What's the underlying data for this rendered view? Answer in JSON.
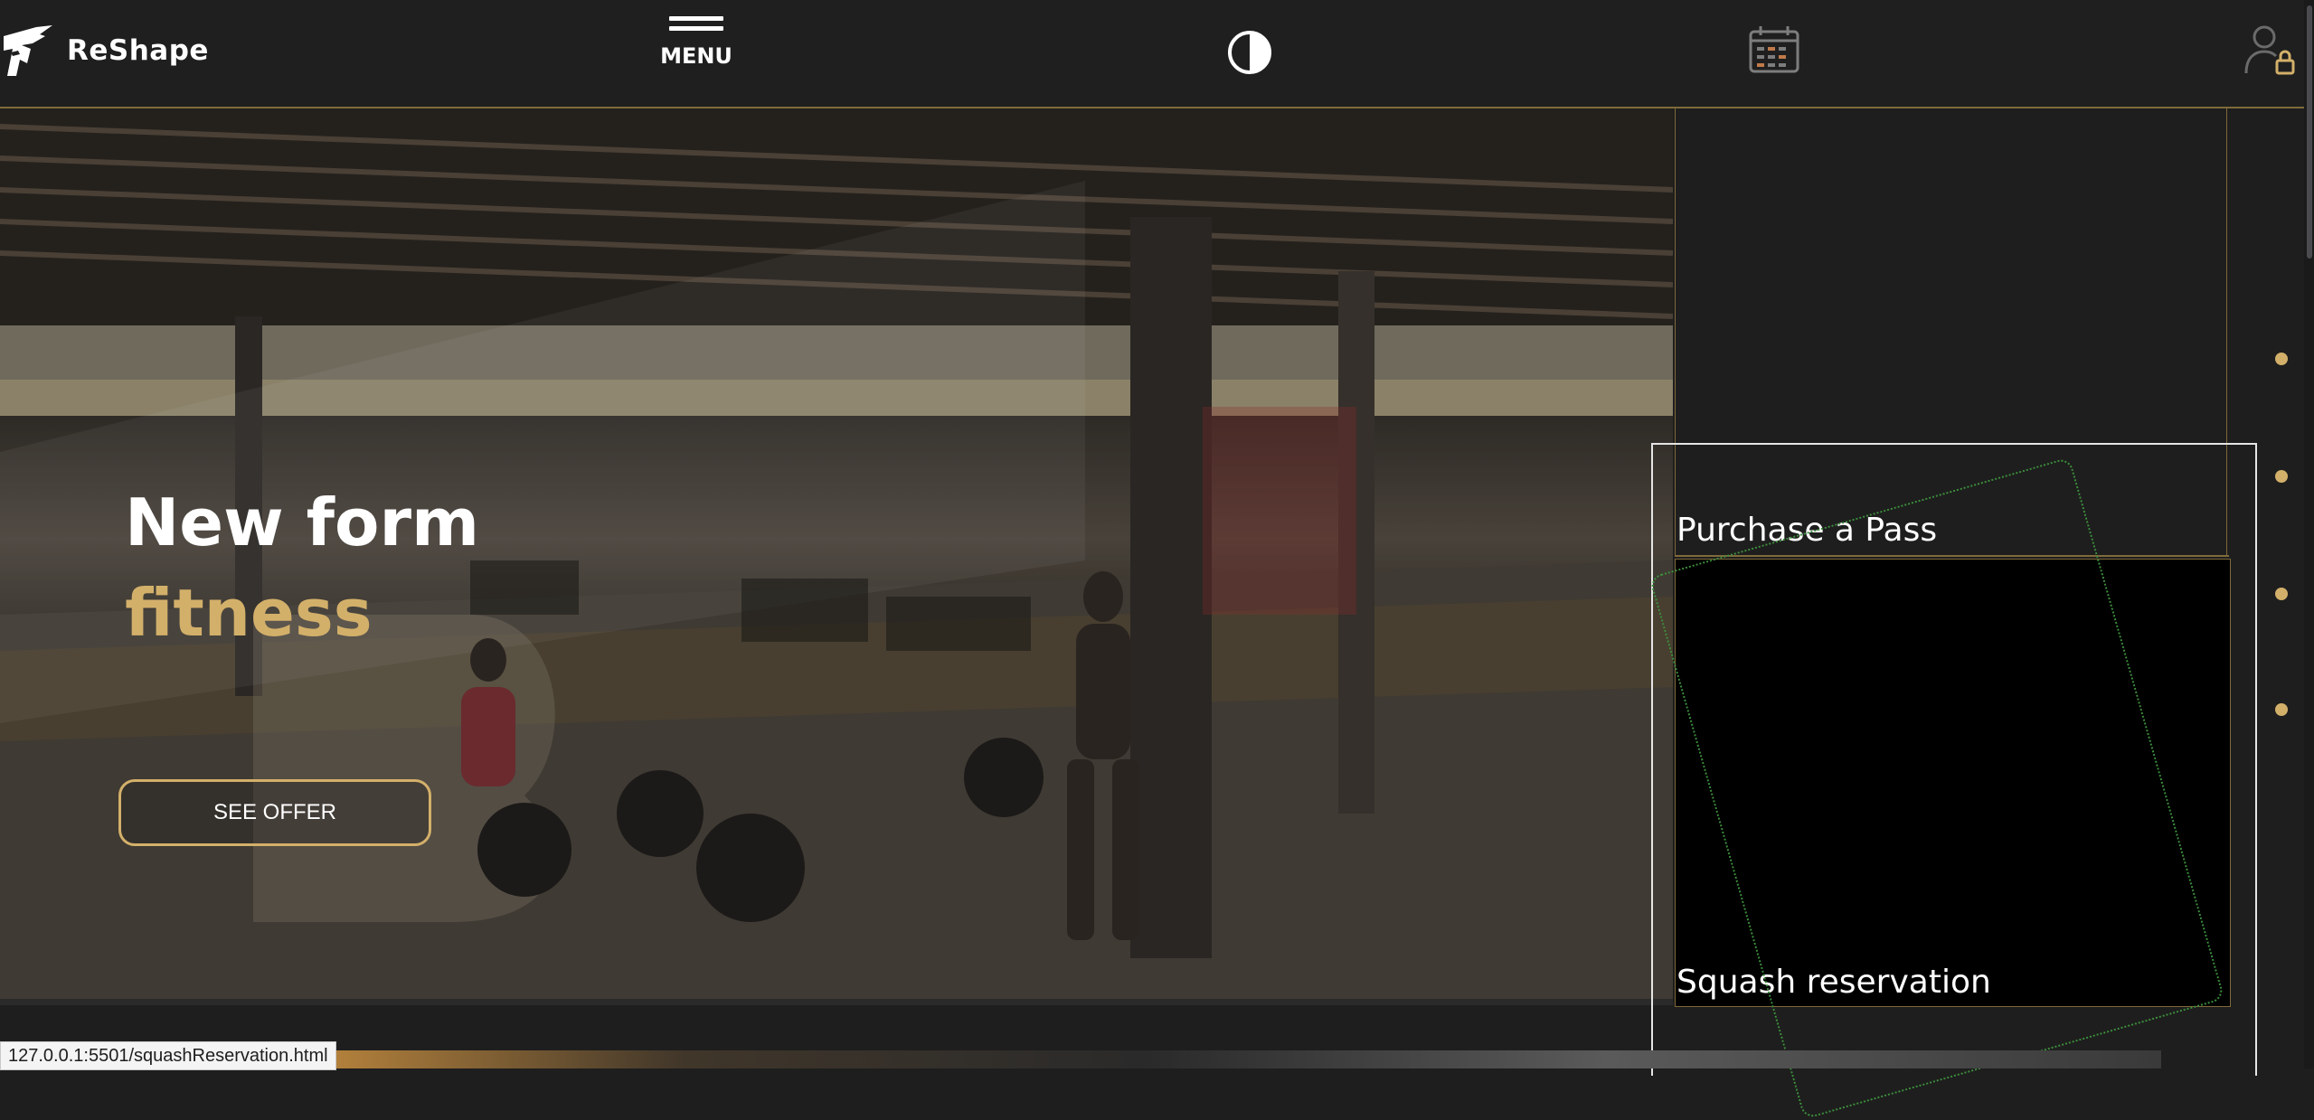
{
  "header": {
    "brand": "ReShape",
    "menu_label": "MENU",
    "icons": [
      "contrast-icon",
      "calendar-icon",
      "user-lock-icon"
    ]
  },
  "hero": {
    "title_line1": "New form",
    "title_line2": "fitness",
    "cta_label": "SEE OFFER"
  },
  "cards": {
    "purchase_label": "Purchase a Pass",
    "squash_label": "Squash reservation"
  },
  "slider": {
    "dot_count": 4,
    "active_index": 0
  },
  "status_bar": {
    "url": "127.0.0.1:5501/squashReservation.html"
  },
  "colors": {
    "accent_gold": "#d3b06a",
    "header_bg": "#1f1f1f",
    "page_bg": "#1e1e1e",
    "debug_outline": "#3c8f3c"
  }
}
